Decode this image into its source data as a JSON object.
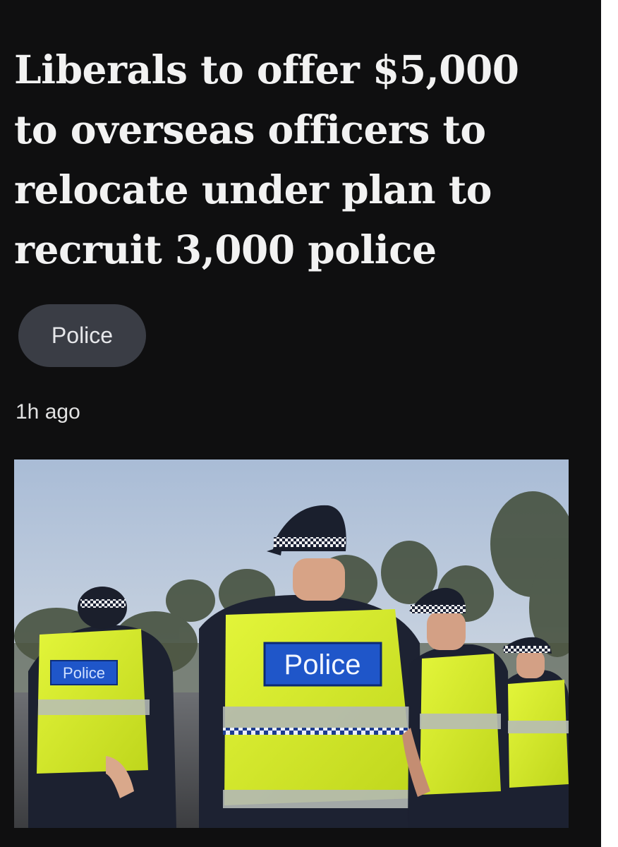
{
  "article": {
    "headline_lines": [
      "Liberals to offer $5,000",
      "to overseas officers to",
      "relocate under plan to",
      "recruit 3,000 police"
    ],
    "topic_tag": "Police",
    "timestamp": "1h ago",
    "image": {
      "vest_text": "Police"
    }
  },
  "colors": {
    "background": "#0f0f10",
    "headline_text": "#f2f2f2",
    "chip_background": "#3a3d45",
    "vest_yellow": "#d4ec2a",
    "vest_badge_blue": "#1f56c9"
  }
}
